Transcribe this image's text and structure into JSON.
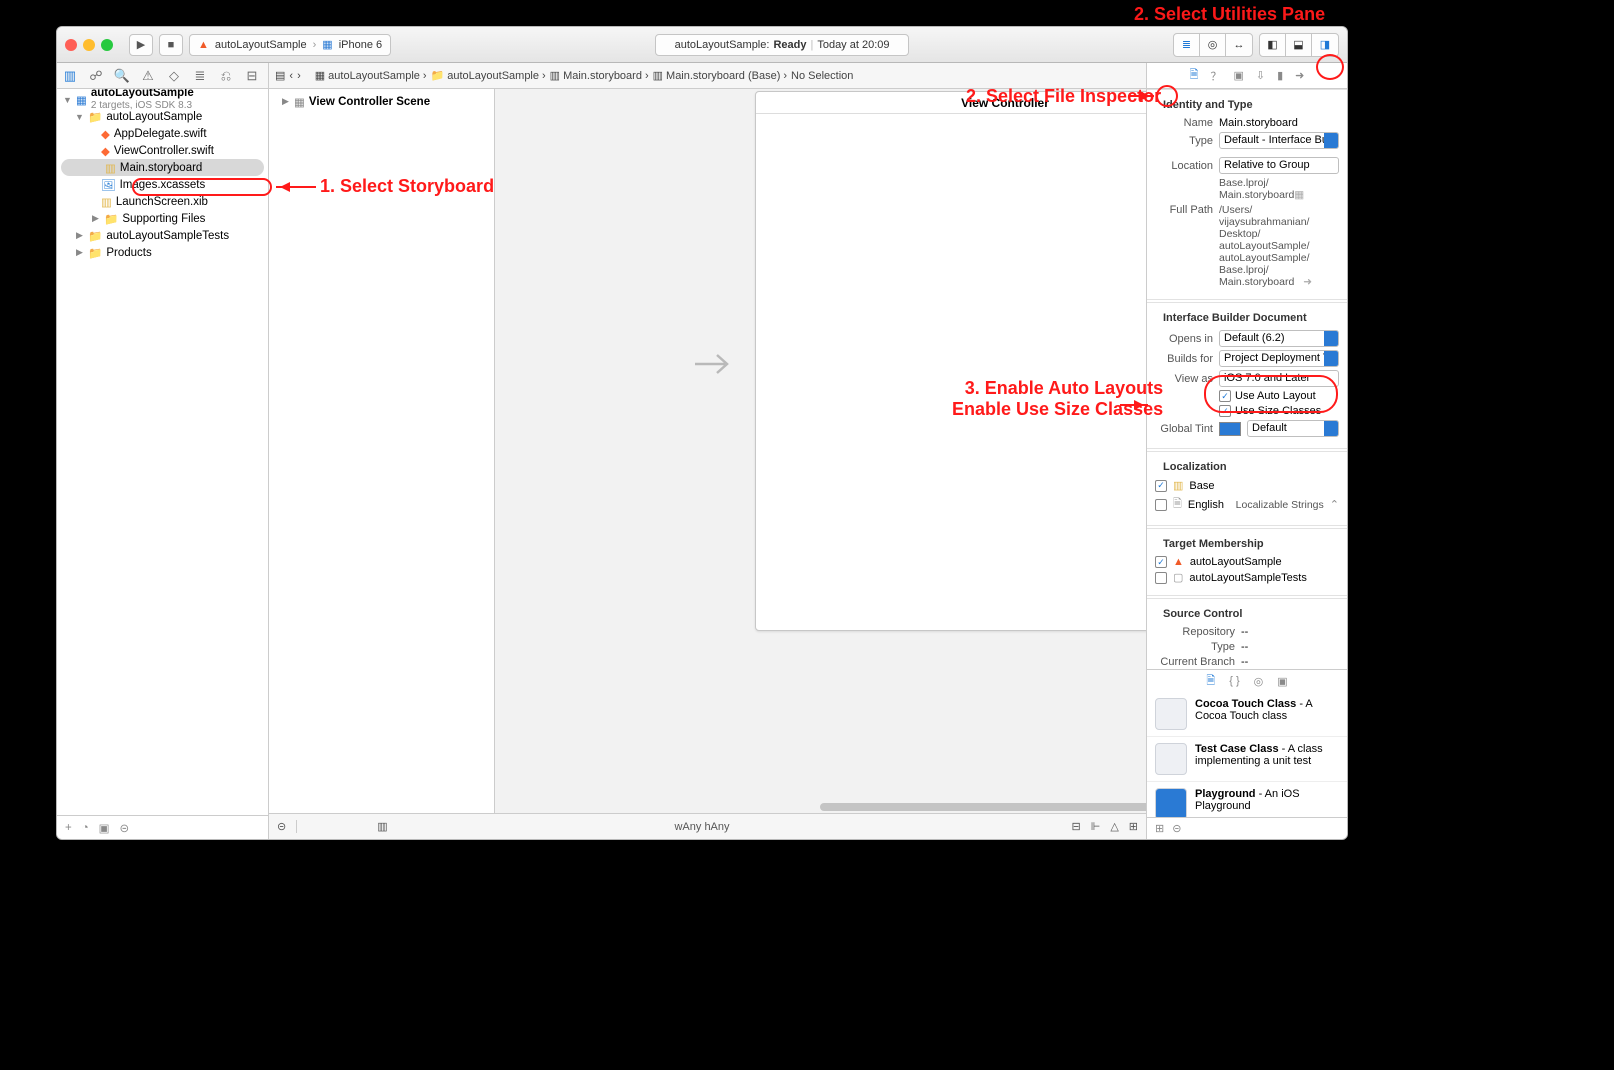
{
  "annotations": {
    "top_right": "2. Select Utilities Pane",
    "select_storyboard": "1. Select Storyboard",
    "select_file_inspector": "2. Select File Inspector",
    "enable_line1": "3. Enable Auto Layouts",
    "enable_line2": "Enable Use Size Classes"
  },
  "toolbar": {
    "scheme_project": "autoLayoutSample",
    "scheme_device": "iPhone 6",
    "status_left": "autoLayoutSample:",
    "status_ready": "Ready",
    "status_sep": "|",
    "status_time": "Today at 20:09"
  },
  "nav": {
    "project": "autoLayoutSample",
    "project_sub": "2 targets, iOS SDK 8.3",
    "group1": "autoLayoutSample",
    "files": {
      "appdelegate": "AppDelegate.swift",
      "viewcontroller": "ViewController.swift",
      "storyboard": "Main.storyboard",
      "images": "Images.xcassets",
      "launch": "LaunchScreen.xib",
      "supporting": "Supporting Files"
    },
    "group_tests": "autoLayoutSampleTests",
    "group_products": "Products"
  },
  "jump": {
    "c1": "autoLayoutSample",
    "c2": "autoLayoutSample",
    "c3": "Main.storyboard",
    "c4": "Main.storyboard (Base)",
    "c5": "No Selection"
  },
  "outline": {
    "scene": "View Controller Scene"
  },
  "canvas": {
    "scene_title": "View Controller"
  },
  "editor_footer": {
    "size_class": "wAny  hAny"
  },
  "insp": {
    "sec_identity": "Identity and Type",
    "name_lbl": "Name",
    "name_val": "Main.storyboard",
    "type_lbl": "Type",
    "type_val": "Default - Interface Bui…",
    "location_lbl": "Location",
    "location_val": "Relative to Group",
    "loc_path1": "Base.lproj/",
    "loc_path2": "Main.storyboard",
    "fullpath_lbl": "Full Path",
    "fp1": "/Users/",
    "fp2": "vijaysubrahmanian/",
    "fp3": "Desktop/",
    "fp4": "autoLayoutSample/",
    "fp5": "autoLayoutSample/",
    "fp6": "Base.lproj/",
    "fp7": "Main.storyboard",
    "sec_ibdoc": "Interface Builder Document",
    "opensin_lbl": "Opens in",
    "opensin_val": "Default (6.2)",
    "buildsfor_lbl": "Builds for",
    "buildsfor_val": "Project Deployment T…",
    "viewas_lbl": "View as",
    "viewas_val": "iOS 7.0 and Later",
    "use_autolayout": "Use Auto Layout",
    "use_sizeclasses": "Use Size Classes",
    "globaltint_lbl": "Global Tint",
    "globaltint_val": "Default",
    "sec_loc": "Localization",
    "loc_base": "Base",
    "loc_en": "English",
    "loc_en_kind": "Localizable Strings",
    "sec_target": "Target Membership",
    "target_main": "autoLayoutSample",
    "target_tests": "autoLayoutSampleTests",
    "sec_source": "Source Control",
    "repo_lbl": "Repository",
    "repo_val": "--",
    "sctype_lbl": "Type",
    "sctype_val": "--",
    "branch_lbl": "Current Branch",
    "branch_val": "--"
  },
  "lib": {
    "i1_name": "Cocoa Touch Class",
    "i1_desc": " - A Cocoa Touch class",
    "i2_name": "Test Case Class",
    "i2_desc": " - A class implementing a unit test",
    "i3_name": "Playground",
    "i3_desc": " - An iOS Playground"
  }
}
